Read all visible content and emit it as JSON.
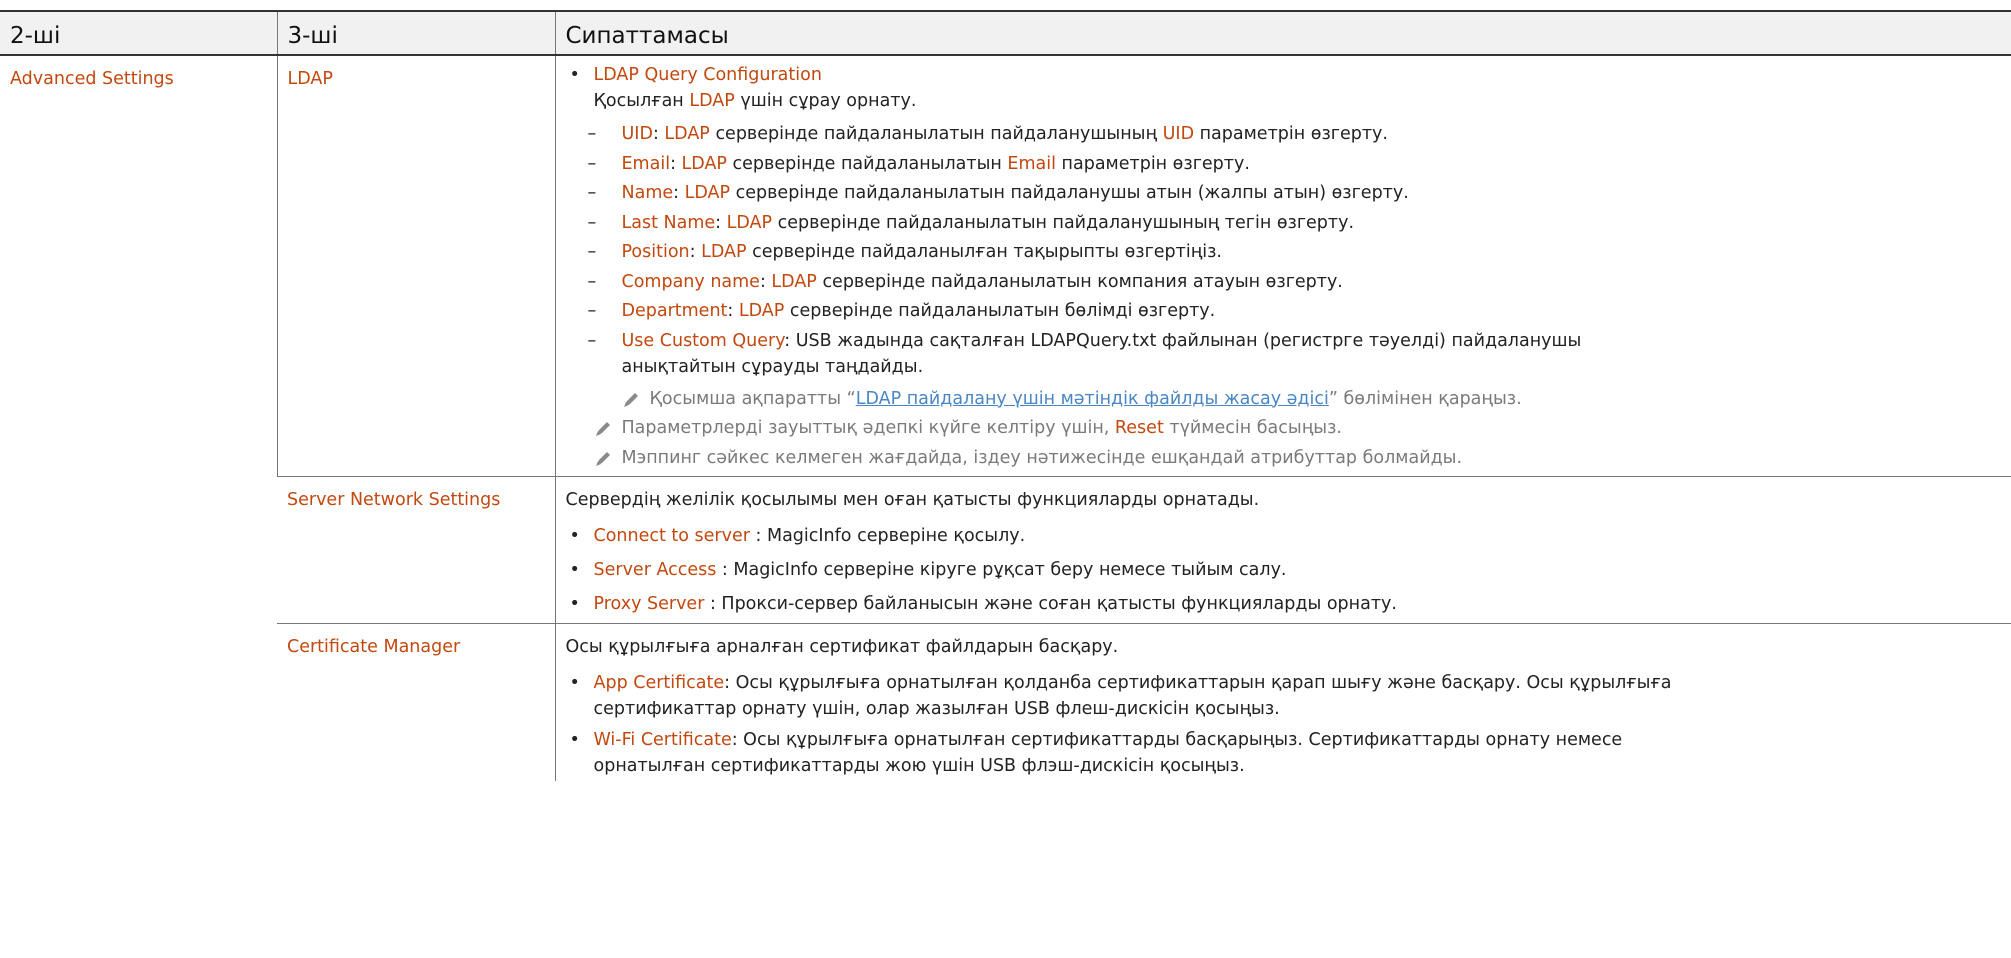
{
  "headers": {
    "col1": "2-ші",
    "col2": "3-ші",
    "col3": "Сипаттамасы"
  },
  "group": "Advanced Settings",
  "ldap": {
    "name": "LDAP",
    "title": "LDAP Query Configuration",
    "intro_pre": "Қосылған ",
    "intro_hl": "LDAP",
    "intro_post": " үшін сұрау орнату.",
    "items": [
      {
        "key": "UID",
        "pre": ": ",
        "hl1": "LDAP",
        "mid": " серверінде пайдаланылатын пайдаланушының ",
        "hl2": "UID",
        "post": " параметрін өзгерту."
      },
      {
        "key": "Email",
        "pre": ": ",
        "hl1": "LDAP",
        "mid": " серверінде пайдаланылатын ",
        "hl2": "Email",
        "post": " параметрін өзгерту."
      },
      {
        "key": "Name",
        "pre": ": ",
        "hl1": "LDAP",
        "mid": " серверінде пайдаланылатын пайдаланушы атын (жалпы атын) өзгерту.",
        "hl2": "",
        "post": ""
      },
      {
        "key": "Last Name",
        "pre": ": ",
        "hl1": "LDAP",
        "mid": " серверінде пайдаланылатын пайдаланушының тегін өзгерту.",
        "hl2": "",
        "post": ""
      },
      {
        "key": "Position",
        "pre": ": ",
        "hl1": "LDAP",
        "mid": " серверінде пайдаланылған тақырыпты өзгертіңіз.",
        "hl2": "",
        "post": ""
      },
      {
        "key": "Company name",
        "pre": ": ",
        "hl1": "LDAP",
        "mid": " серверінде пайдаланылатын компания атауын өзгерту.",
        "hl2": "",
        "post": ""
      },
      {
        "key": "Department",
        "pre": ": ",
        "hl1": "LDAP",
        "mid": " серверінде пайдаланылатын бөлімді өзгерту.",
        "hl2": "",
        "post": ""
      }
    ],
    "custom_key": "Use Custom Query",
    "custom_line1": ": USB жадында сақталған LDAPQuery.txt файлынан (регистрге тәуелді) пайдаланушы",
    "custom_line2": "анықтайтын сұрауды таңдайды.",
    "note1_pre": "Қосымша ақпаратты “",
    "note1_link": "LDAP пайдалану үшін мәтіндік файлды жасау әдісі",
    "note1_post": "” бөлімінен қараңыз.",
    "note2_pre": "Параметрлерді зауыттық әдепкі күйге келтіру үшін, ",
    "note2_hl": "Reset",
    "note2_post": " түймесін басыңыз.",
    "note3": "Мэппинг сәйкес келмеген жағдайда, іздеу нәтижесінде ешқандай атрибуттар болмайды."
  },
  "server": {
    "name": "Server Network Settings",
    "intro": "Сервердің желілік қосылымы мен оған қатысты функцияларды орнатады.",
    "items": [
      {
        "key": "Connect to server",
        "text": " : MagicInfo серверіне қосылу."
      },
      {
        "key": "Server Access",
        "text": " : MagicInfo серверіне кіруге рұқсат беру немесе тыйым салу."
      },
      {
        "key": "Proxy Server",
        "text": " : Прокси-сервер байланысын және соған қатысты функцияларды орнату."
      }
    ]
  },
  "cert": {
    "name": "Certificate Manager",
    "intro": "Осы құрылғыға арналған сертификат файлдарын басқару.",
    "items": [
      {
        "key": "App Certificate",
        "line1": ": Осы құрылғыға орнатылған қолданба сертификаттарын қарап шығу және басқару. Осы құрылғыға",
        "line2": "сертификаттар орнату үшін, олар жазылған USB флеш-дискісін қосыңыз."
      },
      {
        "key": "Wi-Fi Certificate",
        "line1": ": Осы құрылғыға орнатылған сертификаттарды басқарыңыз. Сертификаттарды орнату немесе",
        "line2": "орнатылған сертификаттарды жою үшін USB флэш-дискісін қосыңыз."
      }
    ]
  }
}
